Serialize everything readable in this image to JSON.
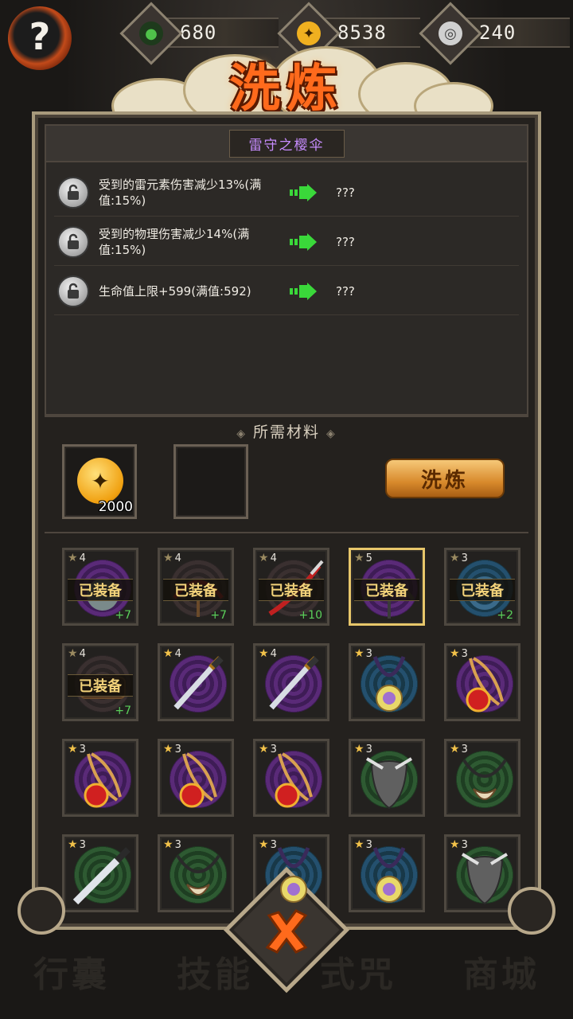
{
  "resources": [
    {
      "name": "jade-icon",
      "value": "680",
      "color": "#4fc24a"
    },
    {
      "name": "gold-icon",
      "value": "8538",
      "color": "#f0b020"
    },
    {
      "name": "silver-icon",
      "value": "240",
      "color": "#c8c8c8"
    }
  ],
  "help_label": "?",
  "title": "洗炼",
  "item_name": "雷守之樱伞",
  "attributes": [
    {
      "text": "受到的雷元素伤害减少13%(满值:15%)",
      "result": "???"
    },
    {
      "text": "受到的物理伤害减少14%(满值:15%)",
      "result": "???"
    },
    {
      "text": "生命值上限+599(满值:592)",
      "result": "???"
    }
  ],
  "materials": {
    "title": "所需材料",
    "coin_count": "2000",
    "refine_label": "洗炼"
  },
  "equipped_label": "已装备",
  "items": [
    {
      "stars": "4",
      "equipped": true,
      "plus": "+7",
      "bg": "purple",
      "icon": "ghost-mask-icon",
      "selected": false
    },
    {
      "stars": "4",
      "equipped": true,
      "plus": "+7",
      "bg": "dark",
      "icon": "red-umbrella-icon",
      "selected": false
    },
    {
      "stars": "4",
      "equipped": true,
      "plus": "+10",
      "bg": "dark",
      "icon": "red-blade-icon",
      "selected": false
    },
    {
      "stars": "5",
      "equipped": true,
      "plus": "",
      "bg": "purple",
      "icon": "umbrella-icon",
      "selected": true
    },
    {
      "stars": "3",
      "equipped": true,
      "plus": "+2",
      "bg": "blue",
      "icon": "ring-icon",
      "selected": false
    },
    {
      "stars": "4",
      "equipped": true,
      "plus": "+7",
      "bg": "dark",
      "icon": "scroll-icon",
      "selected": false
    },
    {
      "stars": "4",
      "equipped": false,
      "plus": "",
      "bg": "purple",
      "icon": "katana-icon",
      "selected": false
    },
    {
      "stars": "4",
      "equipped": false,
      "plus": "",
      "bg": "purple",
      "icon": "katana-icon",
      "selected": false
    },
    {
      "stars": "3",
      "equipped": false,
      "plus": "",
      "bg": "blue",
      "icon": "purple-amulet-icon",
      "selected": false
    },
    {
      "stars": "3",
      "equipped": false,
      "plus": "",
      "bg": "purple",
      "icon": "red-amulet-icon",
      "selected": false
    },
    {
      "stars": "3",
      "equipped": false,
      "plus": "",
      "bg": "purple",
      "icon": "red-amulet-icon",
      "selected": false
    },
    {
      "stars": "3",
      "equipped": false,
      "plus": "",
      "bg": "purple",
      "icon": "red-amulet-icon",
      "selected": false
    },
    {
      "stars": "3",
      "equipped": false,
      "plus": "",
      "bg": "purple",
      "icon": "red-amulet-icon",
      "selected": false
    },
    {
      "stars": "3",
      "equipped": false,
      "plus": "",
      "bg": "green",
      "icon": "fox-mask-icon",
      "selected": false
    },
    {
      "stars": "3",
      "equipped": false,
      "plus": "",
      "bg": "green",
      "icon": "fang-necklace-icon",
      "selected": false
    },
    {
      "stars": "3",
      "equipped": false,
      "plus": "",
      "bg": "green",
      "icon": "dagger-icon",
      "selected": false
    },
    {
      "stars": "3",
      "equipped": false,
      "plus": "",
      "bg": "green",
      "icon": "fang-necklace-icon",
      "selected": false
    },
    {
      "stars": "3",
      "equipped": false,
      "plus": "",
      "bg": "blue",
      "icon": "purple-amulet-icon",
      "selected": false
    },
    {
      "stars": "3",
      "equipped": false,
      "plus": "",
      "bg": "blue",
      "icon": "purple-amulet-icon",
      "selected": false
    },
    {
      "stars": "3",
      "equipped": false,
      "plus": "",
      "bg": "green",
      "icon": "fox-mask-icon",
      "selected": false
    }
  ],
  "background_tabs": [
    "行囊",
    "技能",
    "式咒",
    "商城"
  ]
}
